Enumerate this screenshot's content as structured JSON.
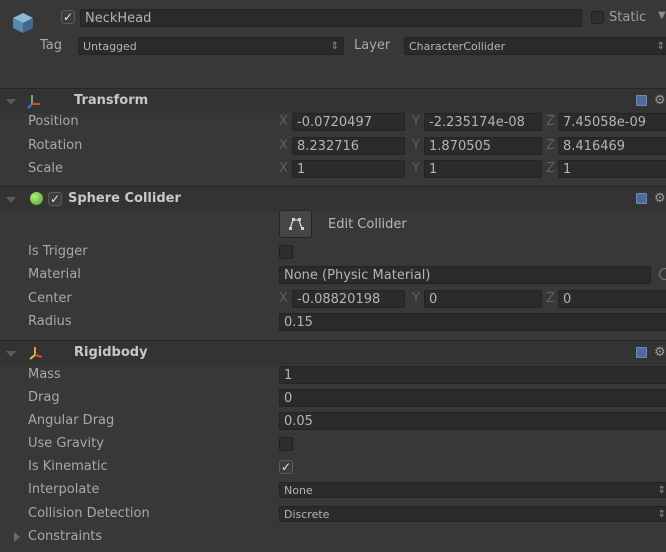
{
  "object": {
    "name": "NeckHead",
    "static_label": "Static",
    "tag_label": "Tag",
    "tag_value": "Untagged",
    "layer_label": "Layer",
    "layer_value": "CharacterCollider"
  },
  "transform": {
    "title": "Transform",
    "position_label": "Position",
    "rotation_label": "Rotation",
    "scale_label": "Scale",
    "axes": {
      "x": "X",
      "y": "Y",
      "z": "Z"
    },
    "position": {
      "x": "-0.0720497",
      "y": "-2.235174e-08",
      "z": "7.45058e-09"
    },
    "rotation": {
      "x": "8.232716",
      "y": "1.870505",
      "z": "8.416469"
    },
    "scale": {
      "x": "1",
      "y": "1",
      "z": "1"
    }
  },
  "sphere_collider": {
    "title": "Sphere Collider",
    "edit_collider_label": "Edit Collider",
    "is_trigger_label": "Is Trigger",
    "material_label": "Material",
    "material_value": "None (Physic Material)",
    "center_label": "Center",
    "center": {
      "x": "-0.08820198",
      "y": "0",
      "z": "0"
    },
    "radius_label": "Radius",
    "radius_value": "0.15"
  },
  "rigidbody": {
    "title": "Rigidbody",
    "mass_label": "Mass",
    "mass_value": "1",
    "drag_label": "Drag",
    "drag_value": "0",
    "angular_drag_label": "Angular Drag",
    "angular_drag_value": "0.05",
    "use_gravity_label": "Use Gravity",
    "is_kinematic_label": "Is Kinematic",
    "interpolate_label": "Interpolate",
    "interpolate_value": "None",
    "collision_detection_label": "Collision Detection",
    "collision_detection_value": "Discrete",
    "constraints_label": "Constraints"
  },
  "colors": {
    "background": "#383838",
    "header": "#333333",
    "field": "#2b2b2b",
    "collider_green": "#6dc23a",
    "text": "#bdbdbd"
  }
}
